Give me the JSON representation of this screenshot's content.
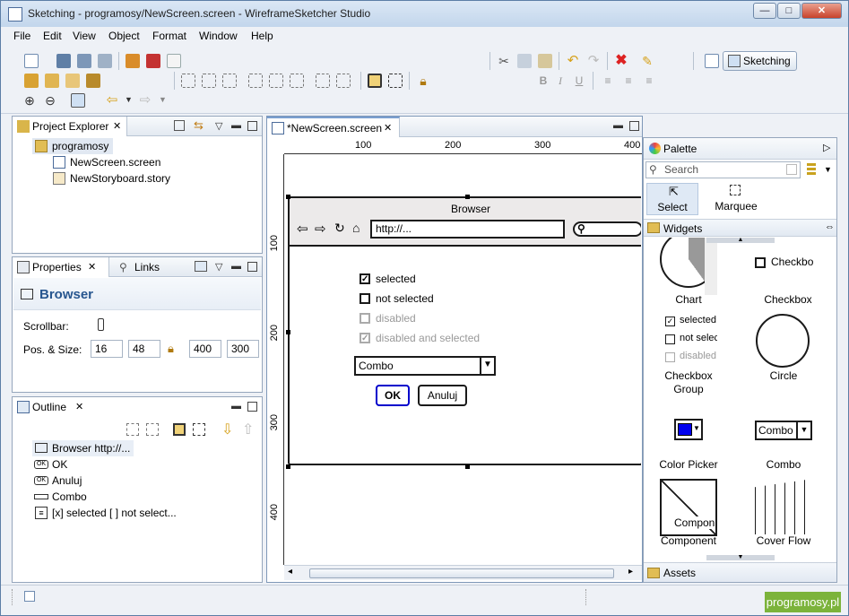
{
  "window": {
    "title": "Sketching - programosy/NewScreen.screen - WireframeSketcher Studio",
    "minimize": "—",
    "maximize": "□",
    "close": "✕"
  },
  "menu": [
    "File",
    "Edit",
    "View",
    "Object",
    "Format",
    "Window",
    "Help"
  ],
  "perspective": {
    "label": "Sketching"
  },
  "project_explorer": {
    "tab": "Project Explorer",
    "items": [
      "programosy",
      "NewScreen.screen",
      "NewStoryboard.story"
    ]
  },
  "properties": {
    "tabs": [
      "Properties",
      "Links"
    ],
    "heading": "Browser",
    "scrollbar_label": "Scrollbar:",
    "pos_size_label": "Pos. & Size:",
    "x": "16",
    "y": "48",
    "w": "400",
    "h": "300"
  },
  "outline": {
    "tab": "Outline",
    "items": [
      "Browser http://...",
      "OK",
      "Anuluj",
      "Combo",
      "[x] selected [ ] not select..."
    ]
  },
  "editor": {
    "tab": "*NewScreen.screen",
    "ruler_h": [
      "100",
      "200",
      "300",
      "400"
    ],
    "ruler_v": [
      "100",
      "200",
      "300",
      "400"
    ],
    "browser": {
      "title": "Browser",
      "url": "http://..."
    },
    "checkboxes": [
      {
        "label": "selected",
        "state": "checked"
      },
      {
        "label": "not selected",
        "state": "unchecked"
      },
      {
        "label": "disabled",
        "state": "disabled"
      },
      {
        "label": "disabled and selected",
        "state": "disabled-checked"
      }
    ],
    "combo": "Combo",
    "ok": "OK",
    "cancel": "Anuluj"
  },
  "palette": {
    "title": "Palette",
    "search_placeholder": "Search",
    "tools": [
      "Select",
      "Marquee"
    ],
    "drawer": "Widgets",
    "widgets": [
      {
        "label": "Chart"
      },
      {
        "label": "Checkbox",
        "preview": "Checkbo"
      },
      {
        "label": "Checkbox Group",
        "items": [
          "selected",
          "not selec",
          "disabled"
        ]
      },
      {
        "label": "Circle"
      },
      {
        "label": "Color Picker"
      },
      {
        "label": "Combo",
        "preview": "Combo"
      },
      {
        "label": "Component",
        "preview": "Compon"
      },
      {
        "label": "Cover Flow"
      }
    ],
    "assets": "Assets"
  },
  "colors": {
    "selection_blue": "#0000cc",
    "badge_green": "#7cb33b"
  },
  "badge": "programosy.pl"
}
